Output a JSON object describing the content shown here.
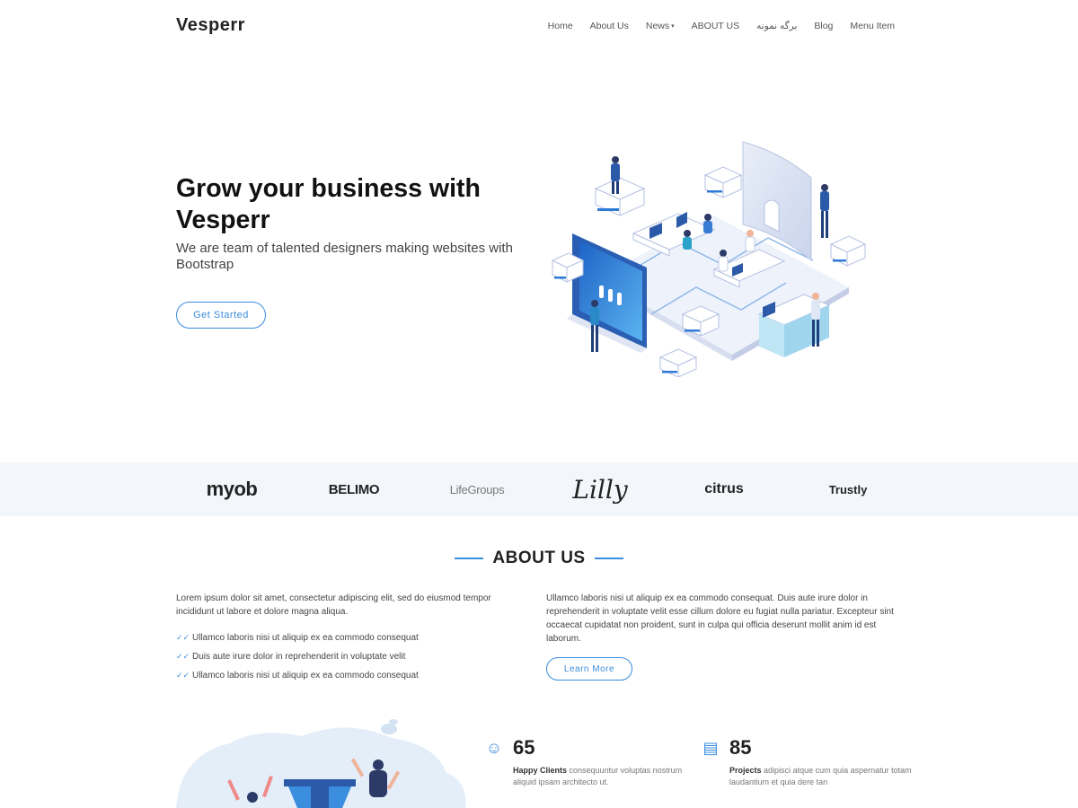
{
  "header": {
    "logo": "Vesperr",
    "nav": [
      {
        "label": "Home"
      },
      {
        "label": "About Us"
      },
      {
        "label": "News",
        "caret": "▾"
      },
      {
        "label": "ABOUT US"
      },
      {
        "label": "برگه نمونه"
      },
      {
        "label": "Blog"
      },
      {
        "label": "Menu Item"
      }
    ]
  },
  "hero": {
    "title": "Grow your business with Vesperr",
    "subtitle": "We are team of talented designers making websites with Bootstrap",
    "cta_label": "Get Started"
  },
  "clients": [
    "myob",
    "BELIMO",
    "LifeGroups",
    "Lilly",
    "citrus",
    "Trustly"
  ],
  "about": {
    "title": "ABOUT US",
    "left_paragraph": "Lorem ipsum dolor sit amet, consectetur adipiscing elit, sed do eiusmod tempor incididunt ut labore et dolore magna aliqua.",
    "list": [
      "Ullamco laboris nisi ut aliquip ex ea commodo consequat",
      "Duis aute irure dolor in reprehenderit in voluptate velit",
      "Ullamco laboris nisi ut aliquip ex ea commodo consequat"
    ],
    "right_paragraph": "Ullamco laboris nisi ut aliquip ex ea commodo consequat. Duis aute irure dolor in reprehenderit in voluptate velit esse cillum dolore eu fugiat nulla pariatur. Excepteur sint occaecat cupidatat non proident, sunt in culpa qui officia deserunt mollit anim id est laborum.",
    "learn_more_label": "Learn More"
  },
  "counts": [
    {
      "icon": "smile-icon",
      "number": "65",
      "label": "Happy Clients",
      "text": "consequuntur voluptas nostrum aliquid ipsam architecto ut."
    },
    {
      "icon": "document-icon",
      "number": "85",
      "label": "Projects",
      "text": "adipisci atque cum quia aspernatur totam laudantium et quia dere tan"
    }
  ],
  "colors": {
    "accent": "#3b8dde",
    "strip_bg": "#f3f7fb"
  }
}
